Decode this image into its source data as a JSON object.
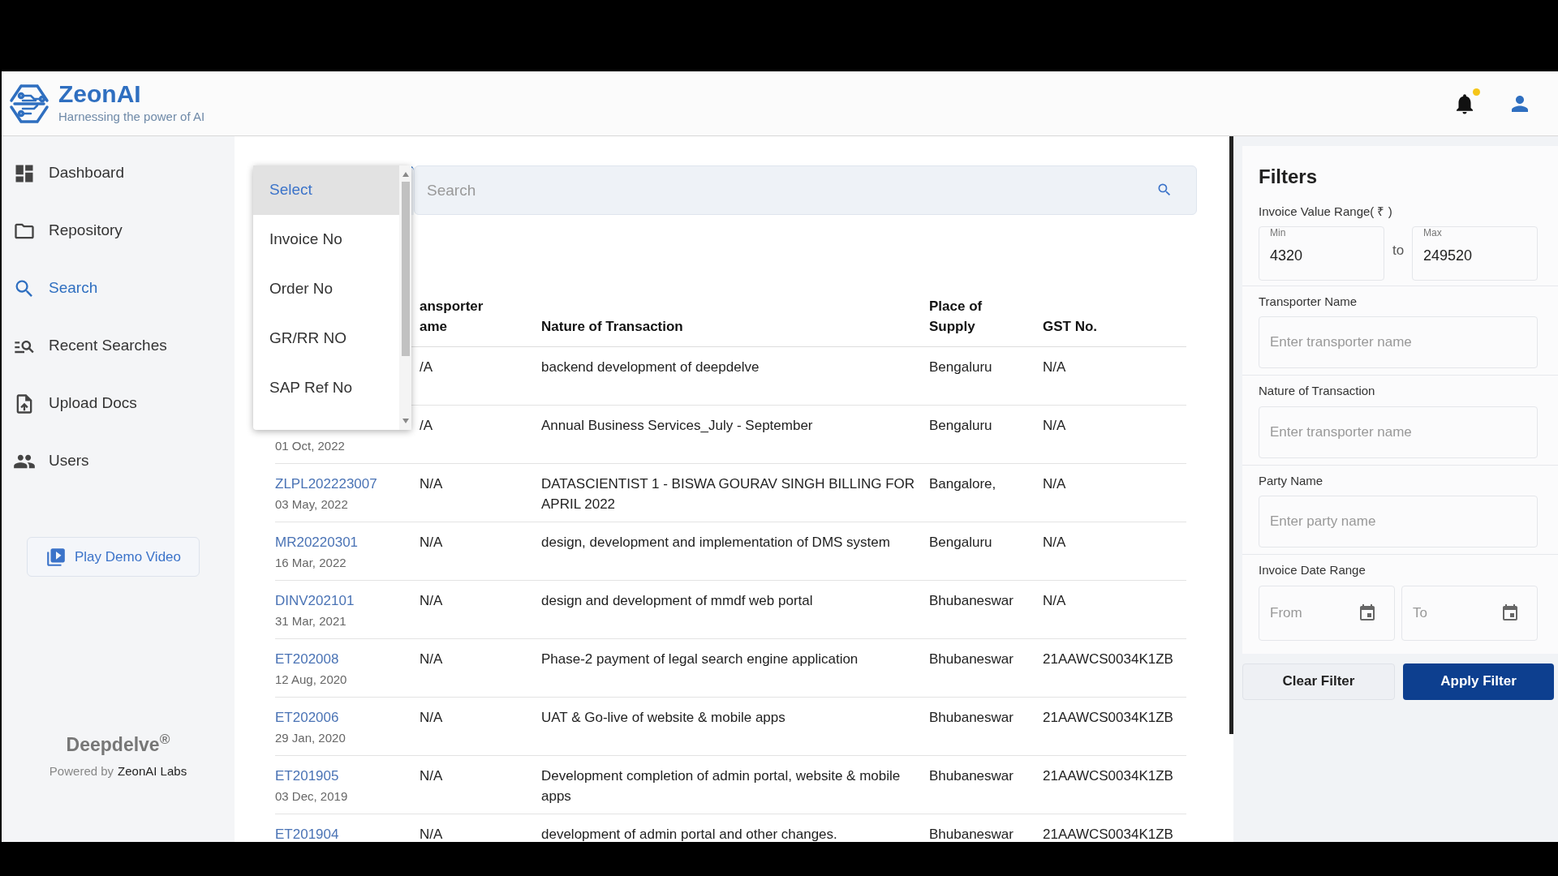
{
  "header": {
    "brand": "ZeonAI",
    "tagline": "Harnessing the power of AI",
    "notification_dot": true
  },
  "sidebar": {
    "items": [
      {
        "label": "Dashboard",
        "selected": false
      },
      {
        "label": "Repository",
        "selected": false
      },
      {
        "label": "Search",
        "selected": true
      },
      {
        "label": "Recent Searches",
        "selected": false
      },
      {
        "label": "Upload Docs",
        "selected": false
      },
      {
        "label": "Users",
        "selected": false
      }
    ],
    "demo_button": "Play Demo Video",
    "product": "Deepdelve$^{®}$",
    "powered_prefix": "Powered by",
    "powered_company": "ZeonAI Labs"
  },
  "search": {
    "dropdown": {
      "options": [
        {
          "label": "Select",
          "selected": true
        },
        {
          "label": "Invoice No",
          "selected": false
        },
        {
          "label": "Order No",
          "selected": false
        },
        {
          "label": "GR/RR NO",
          "selected": false
        },
        {
          "label": "SAP Ref No",
          "selected": false
        }
      ]
    },
    "placeholder": "Search"
  },
  "table": {
    "columns": [
      "ansporter ame",
      "Nature of Transaction",
      "Place of Supply",
      "GST No."
    ],
    "rows": [
      {
        "transporter": "/A",
        "nature": "backend development of deepdelve",
        "place": "Bengaluru",
        "gst": "N/A"
      },
      {
        "date": "01 Oct, 2022",
        "transporter": "/A",
        "nature": "Annual Business Services_July - September",
        "place": "Bengaluru",
        "gst": "N/A"
      },
      {
        "number": "ZLPL202223007",
        "date": "03 May, 2022",
        "transporter": "N/A",
        "nature": "DATASCIENTIST 1 - BISWA GOURAV SINGH BILLING FOR APRIL 2022",
        "place": "Bangalore,",
        "gst": "N/A"
      },
      {
        "number": "MR20220301",
        "date": "16 Mar, 2022",
        "transporter": "N/A",
        "nature": "design, development and implementation of DMS system",
        "place": "Bengaluru",
        "gst": "N/A"
      },
      {
        "number": "DINV202101",
        "date": "31 Mar, 2021",
        "transporter": "N/A",
        "nature": "design and development of mmdf web portal",
        "place": "Bhubaneswar",
        "gst": "N/A"
      },
      {
        "number": "ET202008",
        "date": "12 Aug, 2020",
        "transporter": "N/A",
        "nature": "Phase-2 payment of legal search engine application",
        "place": "Bhubaneswar",
        "gst": "21AAWCS0034K1ZB"
      },
      {
        "number": "ET202006",
        "date": "29 Jan, 2020",
        "transporter": "N/A",
        "nature": "UAT & Go-live of website & mobile apps",
        "place": "Bhubaneswar",
        "gst": "21AAWCS0034K1ZB"
      },
      {
        "number": "ET201905",
        "date": "03 Dec, 2019",
        "transporter": "N/A",
        "nature": "Development completion of admin portal, website & mobile apps",
        "place": "Bhubaneswar",
        "gst": "21AAWCS0034K1ZB"
      },
      {
        "number": "ET201904",
        "transporter": "N/A",
        "nature": "development of admin portal and other changes.",
        "place": "Bhubaneswar",
        "gst": "21AAWCS0034K1ZB"
      }
    ]
  },
  "filters": {
    "title": "Filters",
    "value_range": {
      "label": "Invoice Value Range( ₹ )",
      "min": {
        "label": "Min",
        "value": "4320"
      },
      "separator": "to",
      "max": {
        "label": "Max",
        "value": "249520"
      }
    },
    "text_fields": [
      {
        "label": "Transporter Name",
        "placeholder": "Enter transporter name"
      },
      {
        "label": "Nature of Transaction",
        "placeholder": "Enter transporter name"
      },
      {
        "label": "Party Name",
        "placeholder": "Enter party name"
      }
    ],
    "date_range": {
      "label": "Invoice Date Range",
      "from": {
        "placeholder": "From"
      },
      "to": {
        "placeholder": "To"
      }
    },
    "buttons": [
      {
        "label": "Clear Filter",
        "kind": "secondary"
      },
      {
        "label": "Apply Filter",
        "kind": "primary"
      }
    ]
  }
}
